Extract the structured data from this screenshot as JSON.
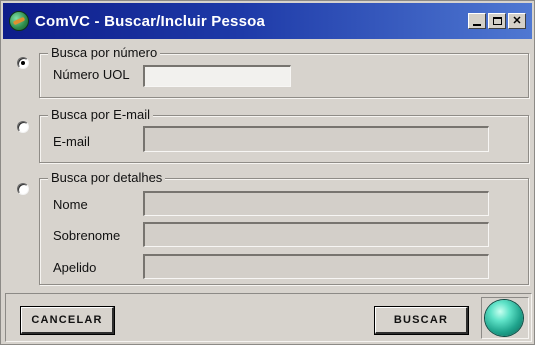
{
  "window": {
    "title": "ComVC - Buscar/Incluir Pessoa",
    "controls": {
      "close_glyph": "✕"
    }
  },
  "search_by_number": {
    "legend": "Busca por número",
    "selected": true,
    "field_label": "Número UOL",
    "field_value": ""
  },
  "search_by_email": {
    "legend": "Busca por E-mail",
    "selected": false,
    "field_label": "E-mail",
    "field_value": ""
  },
  "search_by_details": {
    "legend": "Busca por detalhes",
    "selected": false,
    "fields": [
      {
        "label": "Nome",
        "value": ""
      },
      {
        "label": "Sobrenome",
        "value": ""
      },
      {
        "label": "Apelido",
        "value": ""
      }
    ]
  },
  "footer": {
    "cancel_label": "CANCELAR",
    "search_label": "BUSCAR",
    "status_icon": "globe-icon"
  },
  "colors": {
    "titlebar_start": "#0e1d8a",
    "titlebar_end": "#4f78d2",
    "face": "#d7d3cd",
    "globe": "#1fa38c"
  }
}
